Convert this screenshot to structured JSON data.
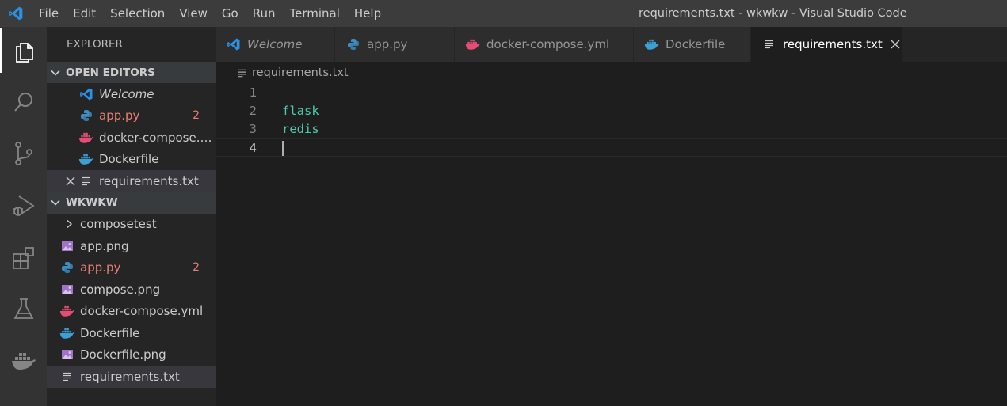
{
  "title_bar": {
    "menu": [
      "File",
      "Edit",
      "Selection",
      "View",
      "Go",
      "Run",
      "Terminal",
      "Help"
    ],
    "window_title": "requirements.txt - wkwkw - Visual Studio Code"
  },
  "activity_bar": [
    "explorer-icon",
    "search-icon",
    "source-control-icon",
    "run-debug-icon",
    "extensions-icon",
    "testing-flask-icon",
    "docker-icon"
  ],
  "sidebar": {
    "title": "EXPLORER",
    "open_editors": {
      "header": "OPEN EDITORS",
      "items": [
        {
          "label": "Welcome",
          "icon": "vscode-icon"
        },
        {
          "label": "app.py",
          "icon": "python-icon",
          "badge": "2"
        },
        {
          "label": "docker-compose.yml",
          "icon": "docker-icon"
        },
        {
          "label": "Dockerfile",
          "icon": "docker-icon"
        },
        {
          "label": "requirements.txt",
          "icon": "text-file-icon"
        }
      ]
    },
    "workspace": {
      "header": "WKWKW",
      "items": [
        {
          "label": "composetest",
          "icon": "chevron-right-icon"
        },
        {
          "label": "app.png",
          "icon": "image-icon"
        },
        {
          "label": "app.py",
          "icon": "python-icon",
          "badge": "2"
        },
        {
          "label": "compose.png",
          "icon": "image-icon"
        },
        {
          "label": "docker-compose.yml",
          "icon": "docker-icon"
        },
        {
          "label": "Dockerfile",
          "icon": "docker-icon"
        },
        {
          "label": "Dockerfile.png",
          "icon": "image-icon"
        },
        {
          "label": "requirements.txt",
          "icon": "text-file-icon"
        }
      ]
    }
  },
  "tabs": [
    {
      "label": "Welcome"
    },
    {
      "label": "app.py"
    },
    {
      "label": "docker-compose.yml"
    },
    {
      "label": "Dockerfile"
    },
    {
      "label": "requirements.txt",
      "active": true
    }
  ],
  "breadcrumb": "requirements.txt",
  "editor": {
    "lines": [
      {
        "num": "1",
        "text": ""
      },
      {
        "num": "2",
        "text": "flask"
      },
      {
        "num": "3",
        "text": "redis"
      },
      {
        "num": "4",
        "text": ""
      }
    ]
  },
  "colors": {
    "accent_blue": "#2b91e6",
    "python_blue": "#3e8ec4",
    "docker_pink": "#e44d74",
    "docker_blue": "#3e9fd6",
    "image_purple": "#a074c4",
    "error_red": "#e37d6f",
    "code_teal": "#4ec9b0"
  }
}
